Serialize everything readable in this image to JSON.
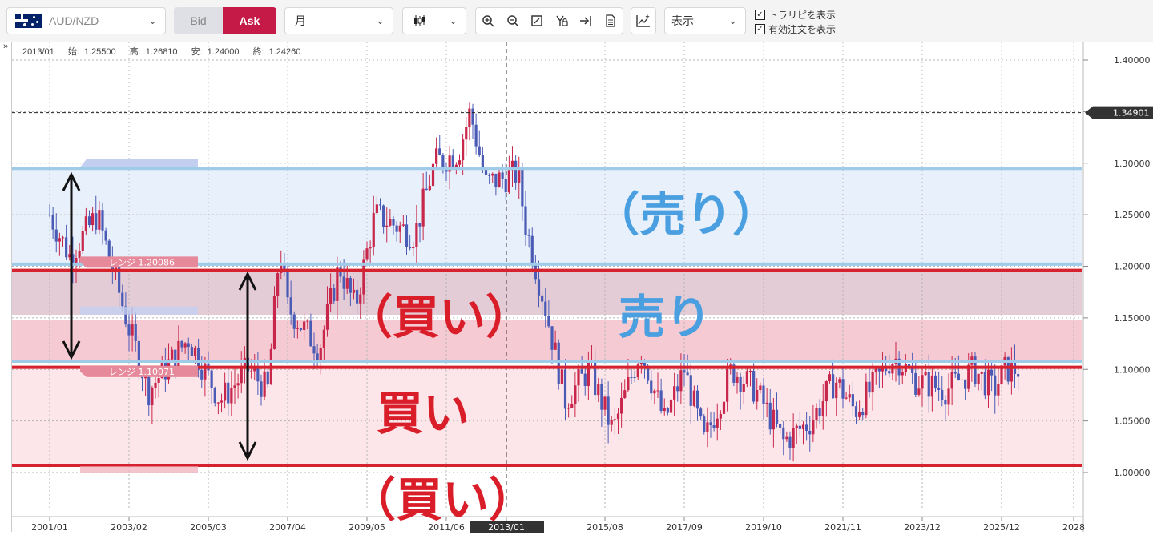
{
  "toolbar": {
    "symbol": "AUD/NZD",
    "bid_label": "Bid",
    "ask_label": "Ask",
    "period": "月",
    "display_select": "表示",
    "show_trail": "トラリピを表示",
    "show_orders": "有効注文を表示"
  },
  "ohlc": {
    "date": "2013/01",
    "open_label": "始:",
    "open": "1.25500",
    "high_label": "高:",
    "high": "1.26810",
    "low_label": "安:",
    "low": "1.24000",
    "close_label": "終:",
    "close": "1.24260"
  },
  "annotations": {
    "sell_paren": "（売り）",
    "sell": "売り",
    "buy_paren_upper": "（買い）",
    "buy": "買い",
    "buy_paren_lower": "（買い）"
  },
  "range_labels": {
    "upper": "レンジ 1.20086",
    "lower": "レンジ 1.10071"
  },
  "colors": {
    "accent_ask": "#c51a47",
    "sell_annotation": "#4a9fe0",
    "buy_annotation": "#d91e2a",
    "bull_candle": "#c8264a",
    "bear_candle": "#4a5bb5"
  },
  "chart_data": {
    "type": "candlestick",
    "y_ticks": [
      "1.40000",
      "1.35000",
      "1.30000",
      "1.25000",
      "1.20000",
      "1.15000",
      "1.10000",
      "1.05000",
      "1.00000"
    ],
    "ylim": [
      0.985,
      1.405
    ],
    "x_ticks": [
      "2001/01",
      "2003/02",
      "2005/03",
      "2007/04",
      "2009/05",
      "2011/06",
      "2013/01",
      "2015/08",
      "2017/09",
      "2019/10",
      "2021/11",
      "2023/12",
      "2025/12",
      "2028"
    ],
    "highlight_x": "2013/01",
    "current_price": "1.34901",
    "current_price_value": 1.34901,
    "horizontal_lines": {
      "blue": [
        1.295,
        1.202,
        1.108
      ],
      "red": [
        1.196,
        1.102,
        1.007
      ]
    },
    "bands": [
      {
        "from": 1.202,
        "to": 1.295,
        "color": "#e8f0fb"
      },
      {
        "from": 1.153,
        "to": 1.196,
        "color": "#e3ccd6"
      },
      {
        "from": 1.108,
        "to": 1.148,
        "color": "#f5cad2"
      },
      {
        "from": 1.007,
        "to": 1.102,
        "color": "#fde6ea"
      }
    ],
    "series_waypoints": [
      [
        2001.0,
        1.25
      ],
      [
        2001.5,
        1.21
      ],
      [
        2002.2,
        1.25
      ],
      [
        2003.0,
        1.14
      ],
      [
        2003.5,
        1.08
      ],
      [
        2004.5,
        1.13
      ],
      [
        2005.3,
        1.07
      ],
      [
        2006.0,
        1.1
      ],
      [
        2006.5,
        1.08
      ],
      [
        2006.8,
        1.22
      ],
      [
        2007.0,
        1.16
      ],
      [
        2007.8,
        1.12
      ],
      [
        2008.3,
        1.2
      ],
      [
        2008.7,
        1.16
      ],
      [
        2009.2,
        1.25
      ],
      [
        2010.2,
        1.23
      ],
      [
        2010.7,
        1.3
      ],
      [
        2011.3,
        1.31
      ],
      [
        2011.6,
        1.35
      ],
      [
        2012.0,
        1.28
      ],
      [
        2012.8,
        1.29
      ],
      [
        2013.0,
        1.24
      ],
      [
        2013.5,
        1.16
      ],
      [
        2014.0,
        1.07
      ],
      [
        2014.6,
        1.1
      ],
      [
        2015.2,
        1.04
      ],
      [
        2015.9,
        1.12
      ],
      [
        2016.5,
        1.05
      ],
      [
        2017.0,
        1.1
      ],
      [
        2017.5,
        1.03
      ],
      [
        2018.2,
        1.1
      ],
      [
        2018.8,
        1.08
      ],
      [
        2019.5,
        1.03
      ],
      [
        2020.2,
        1.05
      ],
      [
        2020.8,
        1.09
      ],
      [
        2021.3,
        1.06
      ],
      [
        2021.7,
        1.08
      ],
      [
        2022.2,
        1.11
      ],
      [
        2022.4,
        1.11
      ],
      [
        2022.8,
        1.09
      ],
      [
        2023.6,
        1.08
      ],
      [
        2024.3,
        1.1
      ],
      [
        2024.8,
        1.08
      ],
      [
        2025.1,
        1.1
      ],
      [
        2025.5,
        1.1
      ]
    ]
  }
}
